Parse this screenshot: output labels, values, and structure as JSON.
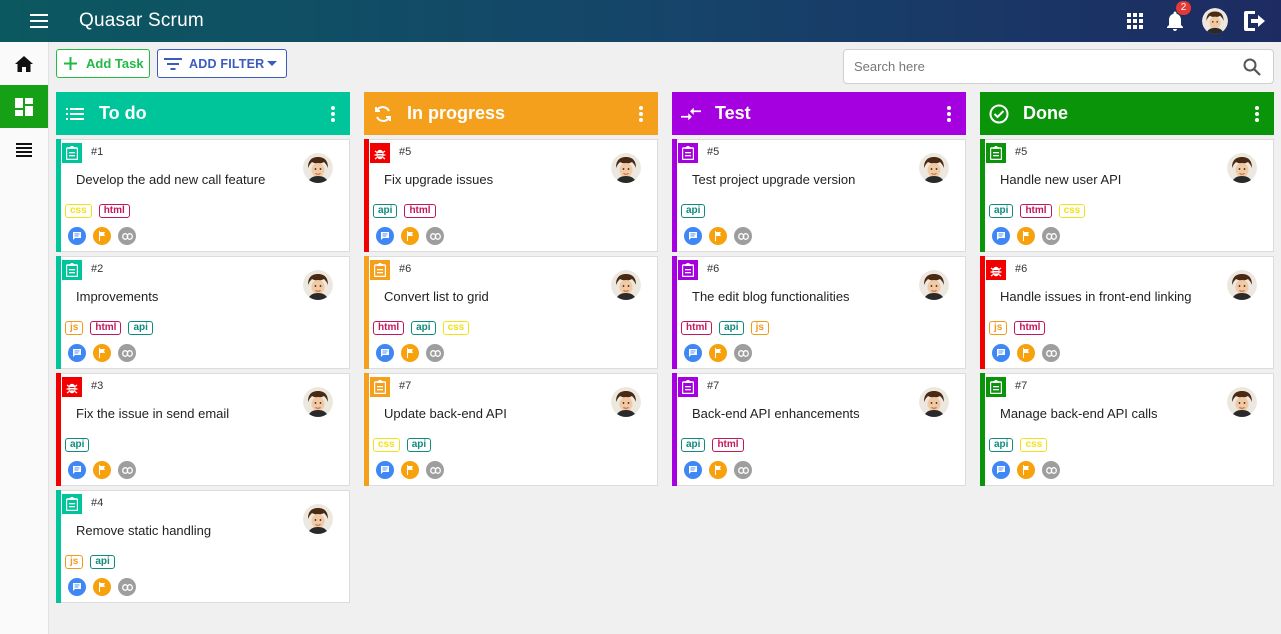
{
  "app": {
    "title": "Quasar Scrum",
    "notification_count": "2"
  },
  "toolbar": {
    "add_task_label": "Add Task",
    "add_filter_label": "ADD FILTER",
    "search_placeholder": "Search here"
  },
  "sidebar": {
    "items": [
      {
        "name": "home",
        "icon": "home-icon"
      },
      {
        "name": "board",
        "icon": "dashboard-icon",
        "active": true
      },
      {
        "name": "list",
        "icon": "list-icon"
      }
    ]
  },
  "colors": {
    "todo": "#00c49a",
    "progress": "#f5a01d",
    "test": "#a400e0",
    "done": "#0a940a",
    "bug": "#f20000"
  },
  "columns": [
    {
      "title": "To do",
      "icon": "list-icon",
      "cards": [
        {
          "num": "#1",
          "title": "Develop the add new call feature",
          "type": "task",
          "tags": [
            "css",
            "html"
          ]
        },
        {
          "num": "#2",
          "title": "Improvements",
          "type": "task",
          "tags": [
            "js",
            "html",
            "api"
          ]
        },
        {
          "num": "#3",
          "title": "Fix the issue in send email",
          "type": "bug",
          "tags": [
            "api"
          ]
        },
        {
          "num": "#4",
          "title": "Remove static handling",
          "type": "task",
          "tags": [
            "js",
            "api"
          ]
        }
      ]
    },
    {
      "title": "In progress",
      "icon": "sync-icon",
      "cards": [
        {
          "num": "#5",
          "title": "Fix upgrade issues",
          "type": "bug",
          "tags": [
            "api",
            "html"
          ]
        },
        {
          "num": "#6",
          "title": "Convert list to grid",
          "type": "task",
          "tags": [
            "html",
            "api",
            "css"
          ]
        },
        {
          "num": "#7",
          "title": "Update back-end API",
          "type": "task",
          "tags": [
            "css",
            "api"
          ]
        }
      ]
    },
    {
      "title": "Test",
      "icon": "compare-arrows-icon",
      "cards": [
        {
          "num": "#5",
          "title": "Test project upgrade version",
          "type": "task",
          "tags": [
            "api"
          ]
        },
        {
          "num": "#6",
          "title": "The edit blog functionalities",
          "type": "task",
          "tags": [
            "html",
            "api",
            "js"
          ]
        },
        {
          "num": "#7",
          "title": "Back-end API enhancements",
          "type": "task",
          "tags": [
            "api",
            "html"
          ]
        }
      ]
    },
    {
      "title": "Done",
      "icon": "check-circle-icon",
      "cards": [
        {
          "num": "#5",
          "title": "Handle new user API",
          "type": "task",
          "tags": [
            "api",
            "html",
            "css"
          ]
        },
        {
          "num": "#6",
          "title": "Handle issues in front-end linking",
          "type": "bug",
          "tags": [
            "js",
            "html"
          ]
        },
        {
          "num": "#7",
          "title": "Manage back-end API calls",
          "type": "task",
          "tags": [
            "api",
            "css"
          ]
        }
      ]
    }
  ]
}
